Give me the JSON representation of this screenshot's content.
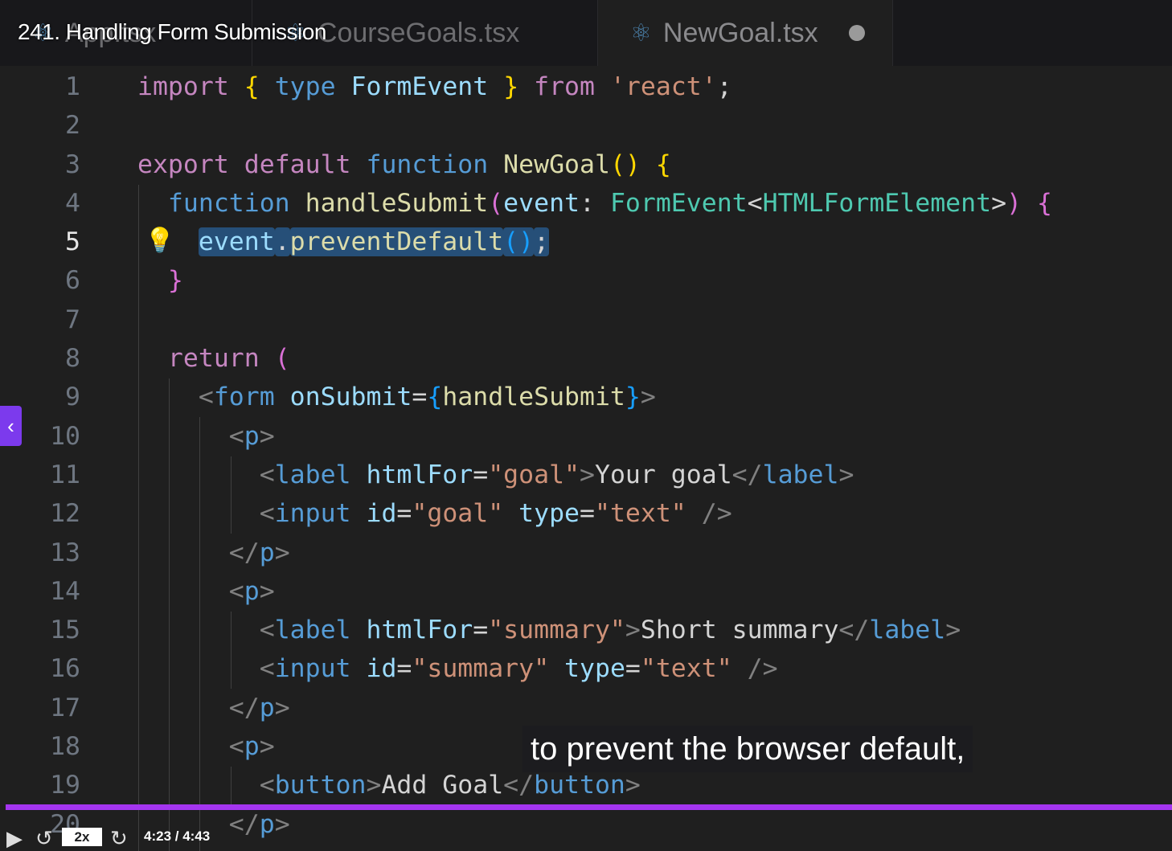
{
  "video": {
    "title": "241. Handling Form Submission",
    "subtitle": "to prevent the browser default,",
    "time": "4:23 / 4:43",
    "speed": "2x",
    "progress": 0.93,
    "accent": "#a435f0"
  },
  "tabs": [
    {
      "label": "App.tsx"
    },
    {
      "label": "CourseGoals.tsx"
    },
    {
      "label": "NewGoal.tsx",
      "active": true,
      "modified": true
    }
  ],
  "active_line": 5,
  "lines": [
    [
      [
        "import ",
        "kw"
      ],
      [
        "{ ",
        "b1"
      ],
      [
        "type ",
        "st"
      ],
      [
        "FormEvent ",
        "vr"
      ],
      [
        "} ",
        "b1"
      ],
      [
        "from ",
        "kw"
      ],
      [
        "'react'",
        "s"
      ],
      [
        ";",
        "t"
      ]
    ],
    [],
    [
      [
        "export ",
        "kw"
      ],
      [
        "default ",
        "kw"
      ],
      [
        "function ",
        "st"
      ],
      [
        "NewGoal",
        "fn"
      ],
      [
        "() ",
        "b1"
      ],
      [
        "{",
        "b1"
      ]
    ],
    [
      [
        "  function ",
        "st"
      ],
      [
        "handleSubmit",
        "fn"
      ],
      [
        "(",
        "b2"
      ],
      [
        "event",
        "vr"
      ],
      [
        ": ",
        "t"
      ],
      [
        "FormEvent",
        "ty"
      ],
      [
        "<",
        "t"
      ],
      [
        "HTMLFormElement",
        "ty"
      ],
      [
        ">",
        "t"
      ],
      [
        ") ",
        "b2"
      ],
      [
        "{",
        "b2"
      ]
    ],
    [
      [
        "    ",
        "t"
      ],
      [
        "event",
        "vr sel"
      ],
      [
        ".",
        "t sel"
      ],
      [
        "preventDefault",
        "fn sel"
      ],
      [
        "()",
        "b3 sel"
      ],
      [
        ";",
        "t sel"
      ]
    ],
    [
      [
        "  }",
        "b2"
      ]
    ],
    [],
    [
      [
        "  return ",
        "kw"
      ],
      [
        "(",
        "b2"
      ]
    ],
    [
      [
        "    <",
        "g"
      ],
      [
        "form ",
        "st"
      ],
      [
        "onSubmit",
        "vr"
      ],
      [
        "=",
        "t"
      ],
      [
        "{",
        "b3"
      ],
      [
        "handleSubmit",
        "fn"
      ],
      [
        "}",
        "b3"
      ],
      [
        ">",
        "g"
      ]
    ],
    [
      [
        "      <",
        "g"
      ],
      [
        "p",
        "st"
      ],
      [
        ">",
        "g"
      ]
    ],
    [
      [
        "        <",
        "g"
      ],
      [
        "label ",
        "st"
      ],
      [
        "htmlFor",
        "vr"
      ],
      [
        "=",
        "t"
      ],
      [
        "\"goal\"",
        "s"
      ],
      [
        ">",
        "g"
      ],
      [
        "Your goal",
        "t"
      ],
      [
        "</",
        "g"
      ],
      [
        "label",
        "st"
      ],
      [
        ">",
        "g"
      ]
    ],
    [
      [
        "        <",
        "g"
      ],
      [
        "input ",
        "st"
      ],
      [
        "id",
        "vr"
      ],
      [
        "=",
        "t"
      ],
      [
        "\"goal\" ",
        "s"
      ],
      [
        "type",
        "vr"
      ],
      [
        "=",
        "t"
      ],
      [
        "\"text\" ",
        "s"
      ],
      [
        "/>",
        "g"
      ]
    ],
    [
      [
        "      </",
        "g"
      ],
      [
        "p",
        "st"
      ],
      [
        ">",
        "g"
      ]
    ],
    [
      [
        "      <",
        "g"
      ],
      [
        "p",
        "st"
      ],
      [
        ">",
        "g"
      ]
    ],
    [
      [
        "        <",
        "g"
      ],
      [
        "label ",
        "st"
      ],
      [
        "htmlFor",
        "vr"
      ],
      [
        "=",
        "t"
      ],
      [
        "\"summary\"",
        "s"
      ],
      [
        ">",
        "g"
      ],
      [
        "Short summary",
        "t"
      ],
      [
        "</",
        "g"
      ],
      [
        "label",
        "st"
      ],
      [
        ">",
        "g"
      ]
    ],
    [
      [
        "        <",
        "g"
      ],
      [
        "input ",
        "st"
      ],
      [
        "id",
        "vr"
      ],
      [
        "=",
        "t"
      ],
      [
        "\"summary\" ",
        "s"
      ],
      [
        "type",
        "vr"
      ],
      [
        "=",
        "t"
      ],
      [
        "\"text\" ",
        "s"
      ],
      [
        "/>",
        "g"
      ]
    ],
    [
      [
        "      </",
        "g"
      ],
      [
        "p",
        "st"
      ],
      [
        ">",
        "g"
      ]
    ],
    [
      [
        "      <",
        "g"
      ],
      [
        "p",
        "st"
      ],
      [
        ">",
        "g"
      ]
    ],
    [
      [
        "        <",
        "g"
      ],
      [
        "button",
        "st"
      ],
      [
        ">",
        "g"
      ],
      [
        "Add Goal",
        "t"
      ],
      [
        "</",
        "g"
      ],
      [
        "button",
        "st"
      ],
      [
        ">",
        "g"
      ]
    ],
    [
      [
        "      </",
        "g"
      ],
      [
        "p",
        "st"
      ],
      [
        ">",
        "g"
      ]
    ]
  ]
}
